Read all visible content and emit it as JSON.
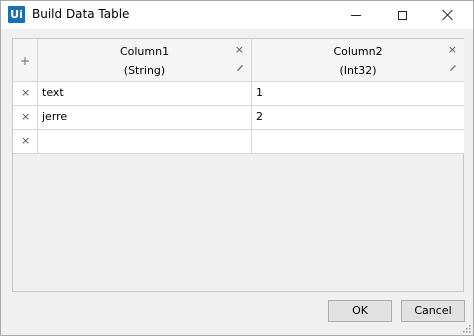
{
  "window": {
    "logo_text": "Ui",
    "title": "Build Data Table"
  },
  "table": {
    "columns": [
      {
        "name": "Column1",
        "type": "(String)"
      },
      {
        "name": "Column2",
        "type": "(Int32)"
      }
    ],
    "rows": [
      [
        "text",
        "1"
      ],
      [
        "jerre",
        "2"
      ],
      [
        "",
        ""
      ]
    ]
  },
  "buttons": {
    "ok": "OK",
    "cancel": "Cancel"
  },
  "glyphs": {
    "add": "+",
    "remove": "×"
  }
}
